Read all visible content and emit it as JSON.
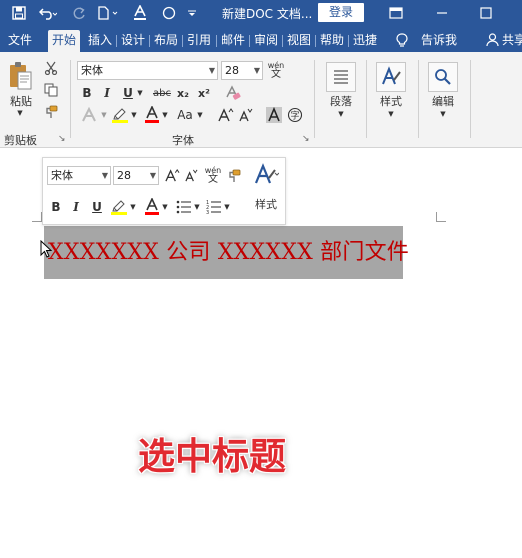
{
  "titlebar": {
    "document_title": "新建DOC 文档...",
    "login_label": "登录"
  },
  "tabs": [
    "文件",
    "开始",
    "插入",
    "设计",
    "布局",
    "引用",
    "邮件",
    "审阅",
    "视图",
    "帮助",
    "迅捷"
  ],
  "tell_me": "告诉我",
  "share": "共享",
  "clipboard": {
    "paste_label": "粘贴",
    "group_label": "剪贴板"
  },
  "font": {
    "name": "宋体",
    "size": "28",
    "phonetic_top": "wén",
    "phonetic_bottom": "文",
    "bold": "B",
    "italic": "I",
    "underline": "U",
    "strike": "abc",
    "sub": "x₂",
    "sup": "x²",
    "aa_label": "Aa",
    "group_label": "字体"
  },
  "paragraph": {
    "label": "段落"
  },
  "styles": {
    "label": "样式"
  },
  "editing": {
    "label": "编辑"
  },
  "minitoolbar": {
    "font_name": "宋体",
    "font_size": "28",
    "styles_label": "样式"
  },
  "document": {
    "heading": "XXXXXXX 公司 XXXXXX 部门文件"
  },
  "caption": "选中标题",
  "colors": {
    "ribbon_blue": "#2b579a",
    "heading_red": "#c00000",
    "highlight_yellow": "#ffff00",
    "font_color_red": "#ff0000",
    "selection_gray": "#a6a6a6"
  }
}
